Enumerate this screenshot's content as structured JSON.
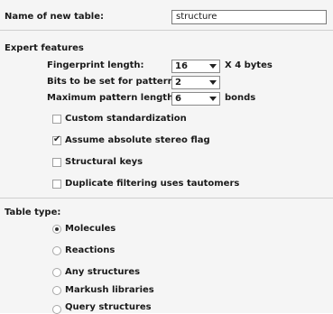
{
  "name_row": {
    "label": "Name of new table:",
    "value": "structure"
  },
  "expert": {
    "heading": "Expert features",
    "fingerprint_label": "Fingerprint length:",
    "fingerprint_value": "16",
    "fingerprint_unit": "X 4 bytes",
    "bits_label": "Bits to be set for patterns:",
    "bits_value": "2",
    "max_pattern_label": "Maximum pattern length:",
    "max_pattern_value": "6",
    "max_pattern_unit": "bonds",
    "checkboxes": [
      {
        "label": "Custom standardization",
        "checked": false
      },
      {
        "label": "Assume absolute stereo flag",
        "checked": true
      },
      {
        "label": "Structural keys",
        "checked": false
      },
      {
        "label": "Duplicate filtering uses tautomers",
        "checked": false
      }
    ]
  },
  "table_type": {
    "heading": "Table type:",
    "options": [
      {
        "label": "Molecules",
        "selected": true
      },
      {
        "label": "Reactions",
        "selected": false
      },
      {
        "label": "Any structures",
        "selected": false
      },
      {
        "label": "Markush libraries",
        "selected": false
      },
      {
        "label": "Query structures",
        "selected": false
      }
    ]
  },
  "icons": {
    "check_mark": "✔"
  }
}
